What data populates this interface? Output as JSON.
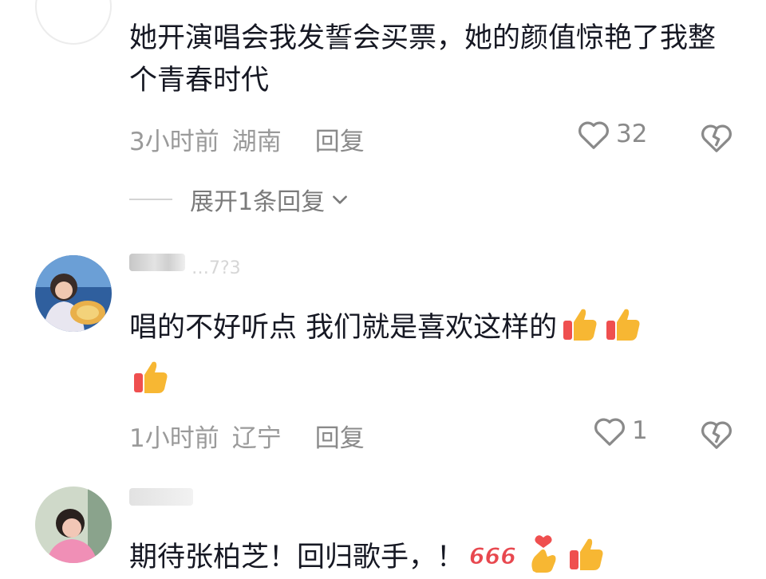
{
  "comments": [
    {
      "username": "",
      "text": "她开演唱会我发誓会买票，她的颜值惊艳了我整个青春时代",
      "time": "3小时前",
      "location": "湖南",
      "reply_label": "回复",
      "likes": "32",
      "expand_label": "展开1条回复",
      "avatar": "empty"
    },
    {
      "username": "…7?3",
      "text": "唱的不好听点  我们就是喜欢这样的",
      "emojis": [
        "thumbs-up-icon",
        "thumbs-up-icon",
        "thumbs-up-icon"
      ],
      "time": "1小时前",
      "location": "辽宁",
      "reply_label": "回复",
      "likes": "1",
      "avatar": "girl-photo"
    },
    {
      "username": "",
      "text": "期待张柏芝！回归歌手，！",
      "emojis": [
        "666-sticker",
        "finger-heart-icon",
        "thumbs-up-icon"
      ],
      "avatar": "woman-photo"
    }
  ],
  "colors": {
    "text": "#161823",
    "meta": "#9a9a9a",
    "icon": "#8a8a8a",
    "thumb": "#f7b733"
  }
}
